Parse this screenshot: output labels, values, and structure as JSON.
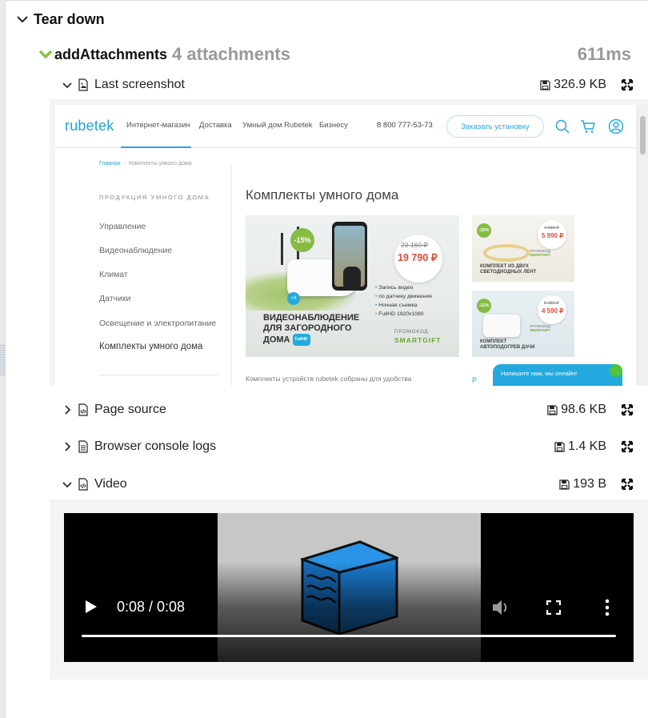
{
  "section": {
    "title": "Tear down"
  },
  "step": {
    "name": "addAttachments",
    "count": "4 attachments",
    "duration": "611ms"
  },
  "attachments": [
    {
      "label": "Last screenshot",
      "size": "326.9 KB",
      "expanded": true,
      "icon": "image-file-icon"
    },
    {
      "label": "Page source",
      "size": "98.6 KB",
      "expanded": false,
      "icon": "code-file-icon"
    },
    {
      "label": "Browser console logs",
      "size": "1.4 KB",
      "expanded": false,
      "icon": "text-file-icon"
    },
    {
      "label": "Video",
      "size": "193 B",
      "expanded": true,
      "icon": "code-file-icon"
    }
  ],
  "screenshot": {
    "logo": "rubetek",
    "nav": [
      "Интернет-магазин",
      "Доставка",
      "Умный дом Rubetek",
      "Бизнесу"
    ],
    "phone": "8 800 777-53-73",
    "order_button": "Заказать установку",
    "breadcrumb_home": "Главная",
    "breadcrumb_sep": "›",
    "breadcrumb_current": "Комплекты умного дома",
    "sidebar_title": "ПРОДУКЦИЯ УМНОГО ДОМА",
    "sidebar_items": [
      "Управление",
      "Видеонаблюдение",
      "Климат",
      "Датчики",
      "Освещение и электропитание",
      "Комплекты умного дома"
    ],
    "heading": "Комплекты умного дома",
    "banner": {
      "discount": "-15%",
      "multiplier": "×4",
      "old_price": "23 160 ₽",
      "new_price": "19 790 ₽",
      "features": [
        "Запись видео",
        "по датчику движения",
        "Ночная съемка",
        "FullHD 1920x1080"
      ],
      "title_lines": [
        "ВИДЕОНАБЛЮДЕНИЕ",
        "ДЛЯ ЗАГОРОДНОГО",
        "ДОМА"
      ],
      "fullhd": "FullHD",
      "promo_label": "ПРОМОКОД:",
      "promo_code": "SMARTGIFT"
    },
    "mini1": {
      "discount": "-25%",
      "old_price": "7 980 ₽",
      "new_price": "5 990 ₽",
      "promo_label": "ПРОМОКОД",
      "promo_code": "SMARTGIFT",
      "caption": [
        "КОМПЛЕКТ ИЗ ДВУХ",
        "СВЕТОДИОДНЫХ ЛЕНТ"
      ]
    },
    "mini2": {
      "discount": "-11%",
      "old_price": "5 180 ₽",
      "new_price": "4 590 ₽",
      "promo_label": "ПРОМОКОД",
      "promo_code": "SMARTGIFT",
      "caption": [
        "КОМПЛЕКТ",
        "АВТОПОДОГРЕВ ДАЧИ"
      ]
    },
    "description": "Комплекты устройств rubetek собраны для удобства",
    "description_r": "Р",
    "chat": "Напишите нам, мы онлайн!"
  },
  "video": {
    "time": "0:08 / 0:08",
    "progress": 1.0
  },
  "colors": {
    "accent": "#23a9de",
    "step_check": "#8bc34a",
    "muted": "#999999"
  }
}
